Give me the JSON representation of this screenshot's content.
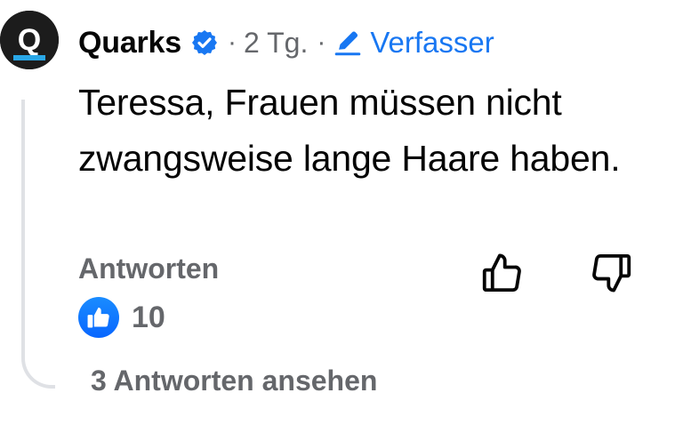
{
  "comment": {
    "author": "Quarks",
    "separator1": "·",
    "time": "2 Tg.",
    "separator2": "·",
    "role": "Verfasser",
    "text": "Teressa, Frauen müssen nicht zwangsweise lange Haare haben.",
    "reply_label": "Antworten",
    "reaction_count": "10",
    "view_replies_label": "3 Antworten ansehen"
  },
  "avatar": {
    "letter": "Q",
    "icon": "quarks-logo-avatar"
  },
  "icons": {
    "verified": "verified-badge-icon",
    "pencil": "pencil-icon",
    "like": "thumbs-up-icon",
    "dislike": "thumbs-down-icon",
    "reaction": "like-reaction-icon"
  },
  "colors": {
    "accent": "#1877f2",
    "secondary_text": "#65676b",
    "primary_text": "#050505",
    "avatar_bg": "#1c1c1c",
    "avatar_stripe": "#2aa7e6",
    "thread_line": "#dfe1e5"
  }
}
